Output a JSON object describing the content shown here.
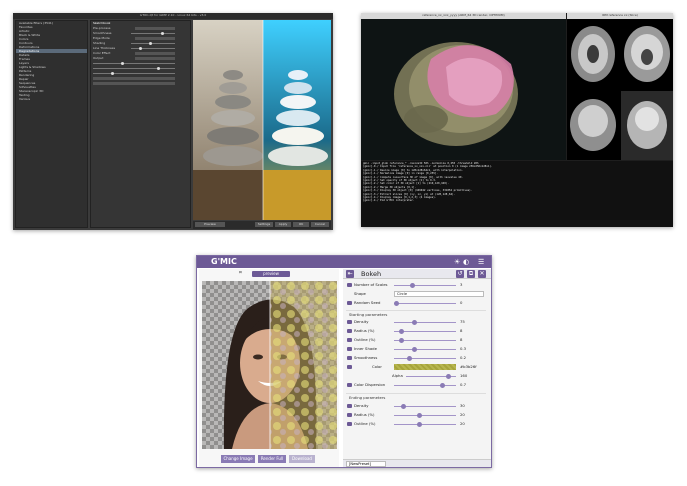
{
  "screenshot1": {
    "title": "G'MIC-Qt for GIMP 2.10 - Linux 64 bits - v3.0",
    "filters": [
      "Available filters (3541)",
      "Favorites",
      "Artistic",
      "Black & White",
      "Colors",
      "Contours",
      "Deformations",
      "Degradations",
      "Details",
      "Frames",
      "Layers",
      "Lights & Shadows",
      "Patterns",
      "Rendering",
      "Repair",
      "Sequences",
      "Silhouettes",
      "Stereoscopic 3D",
      "Testing",
      "Various"
    ],
    "selected_filter": "Degradations",
    "params_title": "Sketchbook",
    "params": [
      "Pre-process",
      "Smoothness",
      "Edge Mode",
      "Shading",
      "Line Thickness",
      "Color Effect",
      "Output"
    ],
    "preview_label": "Preview",
    "buttons": [
      "Settings",
      "Apply",
      "OK",
      "Cancel"
    ]
  },
  "screenshot2": {
    "title3d": "reference_xx_xxx_yyyy (ARM_64 3D render, OPTIMUM)",
    "title_slices": "IRM reference xx (Slice)",
    "terminal_lines": [
      "gmic -input_glob reference_* -resize3d 50% -normalize 0,255 -threshold 20%",
      "[gmic]-0./ Input file 'reference_xx_xxx.nii' at position 0 (1 image 256x256x128x1).",
      "[gmic]-1./ Resize image [0] to 128x128x64x1, with interpolation.",
      "[gmic]-1./ Normalize image [0] in range [0,255].",
      "[gmic]-1./ Compute isosurface 3D of image [0], with isovalue 40.",
      "[gmic]-2./ Set opacity of 3D object [1] to 0.3.",
      "[gmic]-2./ Set color of 3D object [1] to (210,120,160).",
      "[gmic]-2./ Merge 3D objects [0,1].",
      "[gmic]-3./ Display 3D object [0] (166042 vertices, 331852 primitives).",
      "[gmic]-3./ Extract slices [0] (xy, xz, yz) at (128,128,64).",
      "[gmic]-4./ Display images [0,1,2,3] (4 images).",
      "[gmic]-4./ End G'MIC interpreter."
    ]
  },
  "screenshot3": {
    "logo": "G'MIC",
    "preview_label": "preview",
    "filter_title": "Bokeh",
    "params": [
      {
        "label": "Number of Scales",
        "value": "3"
      },
      {
        "label": "Shape",
        "value": "Circle"
      },
      {
        "label": "Random Seed",
        "value": "0"
      }
    ],
    "section_start": "Starting parameters",
    "start_params": [
      {
        "label": "Density",
        "value": "75"
      },
      {
        "label": "Radius (%)",
        "value": "8"
      },
      {
        "label": "Outline (%)",
        "value": "8"
      },
      {
        "label": "Inner Shade",
        "value": "0.3"
      },
      {
        "label": "Smoothness",
        "value": "0.2"
      },
      {
        "label": "Color",
        "value": "#b3b26f"
      },
      {
        "label": "Alpha",
        "value": "160"
      },
      {
        "label": "Color Dispersion",
        "value": "0.7"
      }
    ],
    "section_end": "Ending parameters",
    "end_params": [
      {
        "label": "Density",
        "value": "30"
      },
      {
        "label": "Radius (%)",
        "value": "20"
      },
      {
        "label": "Outline (%)",
        "value": "20"
      }
    ],
    "buttons": [
      "Change Image",
      "Render Full",
      "Download"
    ],
    "preset": "[NewPreset]"
  }
}
